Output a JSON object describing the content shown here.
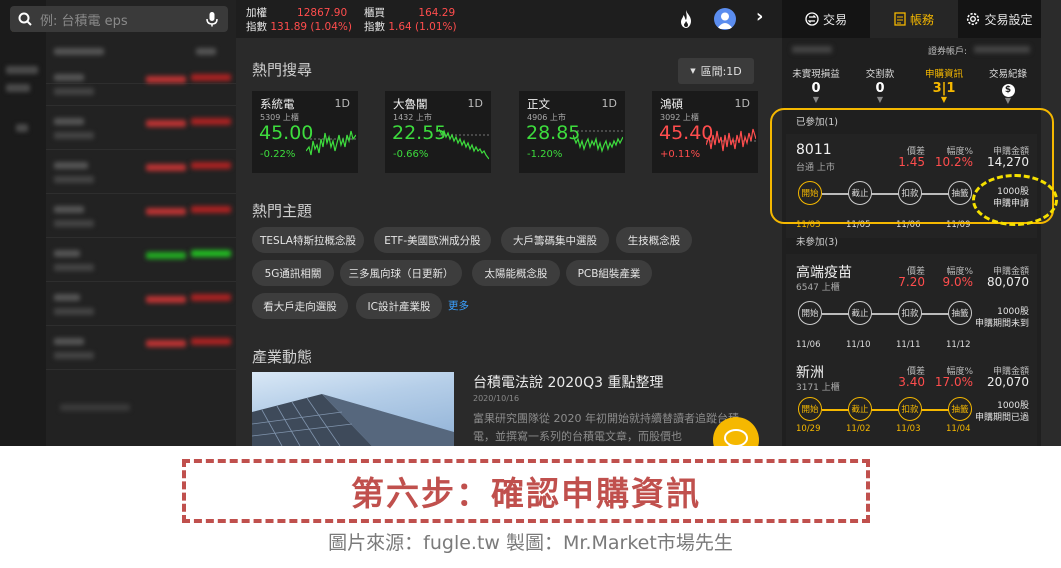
{
  "search": {
    "placeholder": "例: 台積電 eps"
  },
  "indices": [
    {
      "name": "加權",
      "value": "12867.90",
      "label": "指數",
      "change": "131.89 (1.04%)"
    },
    {
      "name": "櫃買",
      "value": "164.29",
      "label": "指數",
      "change": "1.64 (1.01%)"
    }
  ],
  "hot_search": {
    "title": "熱門搜尋",
    "range_button": "區間:1D",
    "cards": [
      {
        "name": "系統電",
        "period": "1D",
        "sub": "5309 上櫃",
        "price": "45.00",
        "change": "-0.22%",
        "dir": "down"
      },
      {
        "name": "大魯閣",
        "period": "1D",
        "sub": "1432 上市",
        "price": "22.55",
        "change": "-0.66%",
        "dir": "down"
      },
      {
        "name": "正文",
        "period": "1D",
        "sub": "4906 上市",
        "price": "28.85",
        "change": "-1.20%",
        "dir": "down"
      },
      {
        "name": "鴻碩",
        "period": "1D",
        "sub": "3092 上櫃",
        "price": "45.40",
        "change": "+0.11%",
        "dir": "up"
      }
    ]
  },
  "hot_topics": {
    "title": "熱門主題",
    "tags": [
      "TESLA特斯拉概念股",
      "ETF-美國歐洲成分股",
      "大戶籌碼集中選股",
      "生技概念股",
      "5G通訊相關",
      "三多風向球（日更新）",
      "太陽能概念股",
      "PCB組裝產業",
      "看大戶走向選股",
      "IC設計產業股"
    ],
    "more": "更多"
  },
  "industry_news": {
    "title": "產業動態",
    "headline": "台積電法說 2020Q3 重點整理",
    "date": "2020/10/16",
    "body": "富果研究團隊從 2020 年初開始就持續替讀者追蹤台積電，並撰寫一系列的台積電文章，而股價也"
  },
  "right_panel": {
    "tabs": [
      "交易",
      "帳務",
      "交易設定"
    ],
    "account_label": "證券帳戶:",
    "stats": [
      {
        "label": "未實現損益",
        "value": "0"
      },
      {
        "label": "交割款",
        "value": "0"
      },
      {
        "label": "申購資訊",
        "value": "3|1"
      },
      {
        "label": "交易紀錄",
        "value": "$"
      }
    ],
    "joined_label": "已參加(1)",
    "not_joined_label": "未參加(3)",
    "col_spread": "價差",
    "col_pct": "幅度%",
    "col_amount": "申購金額",
    "steps": [
      "開始",
      "截止",
      "扣款",
      "抽籤"
    ],
    "ipos": [
      {
        "name": "8011",
        "sub": "台通 上市",
        "spread": "1.45",
        "pct": "10.2%",
        "amount": "14,270",
        "dates": [
          "11/03",
          "11/05",
          "11/06",
          "11/09"
        ],
        "active": 1,
        "qty": "1000股",
        "status": "申購申請"
      },
      {
        "name": "高端疫苗",
        "sub": "6547 上櫃",
        "spread": "7.20",
        "pct": "9.0%",
        "amount": "80,070",
        "dates": [
          "11/06",
          "11/10",
          "11/11",
          "11/12"
        ],
        "active": 0,
        "qty": "1000股",
        "status": "申購期間未到"
      },
      {
        "name": "新洲",
        "sub": "3171 上櫃",
        "spread": "3.40",
        "pct": "17.0%",
        "amount": "20,070",
        "dates": [
          "10/29",
          "11/02",
          "11/03",
          "11/04"
        ],
        "active": 4,
        "qty": "1000股",
        "status": "申購期間已過"
      }
    ]
  },
  "caption": "第六步：確認申購資訊",
  "credit": "圖片來源：fugle.tw  製圖：Mr.Market市場先生",
  "colors": {
    "up": "#ff4d4d",
    "down": "#3ddc3d",
    "accent": "#f5b800",
    "link": "#3aa0ff"
  }
}
